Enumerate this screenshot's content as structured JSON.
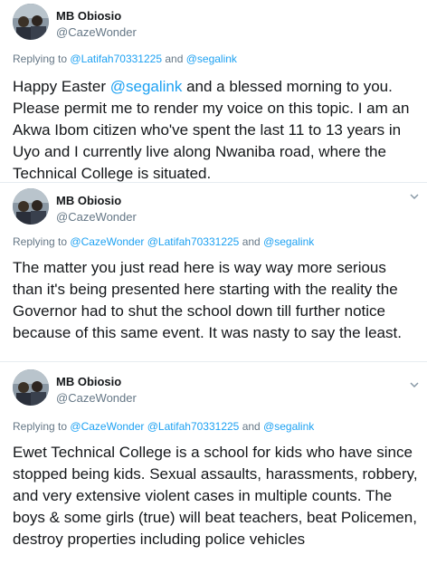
{
  "tweets": [
    {
      "name": "MB Obiosio",
      "handle": "@CazeWonder",
      "replying_prefix": "Replying to",
      "replying_to": [
        "@Latifah70331225",
        "and",
        "@segalink"
      ],
      "text_parts": [
        "Happy Easter ",
        "@segalink",
        " and a blessed morning to you. Please permit me to render my voice on this topic. I am an Akwa Ibom citizen who've spent the last 11 to 13 years in Uyo and I currently live along Nwaniba road, where the Technical College is situated."
      ]
    },
    {
      "name": "MB Obiosio",
      "handle": "@CazeWonder",
      "replying_prefix": "Replying to",
      "replying_to": [
        "@CazeWonder",
        "@Latifah70331225",
        "and",
        "@segalink"
      ],
      "text": "The matter you just read here is way way more serious than it's being presented here starting with the reality the Governor had to shut the school down till further notice because of this same event. It was nasty to say the least."
    },
    {
      "name": "MB Obiosio",
      "handle": "@CazeWonder",
      "replying_prefix": "Replying to",
      "replying_to": [
        "@CazeWonder",
        "@Latifah70331225",
        "and",
        "@segalink"
      ],
      "text": "Ewet Technical College is a school for kids who have since stopped being kids. Sexual assaults, harassments, robbery, and very extensive violent cases in multiple counts. The boys & some girls (true) will beat teachers, beat Policemen, destroy properties including police vehicles"
    }
  ],
  "colors": {
    "link": "#1da1f2",
    "secondary": "#657786",
    "text": "#14171a",
    "divider": "#e6ecf0"
  },
  "icons": {
    "menu": "chevron-down-icon",
    "avatar": "profile-photo"
  }
}
